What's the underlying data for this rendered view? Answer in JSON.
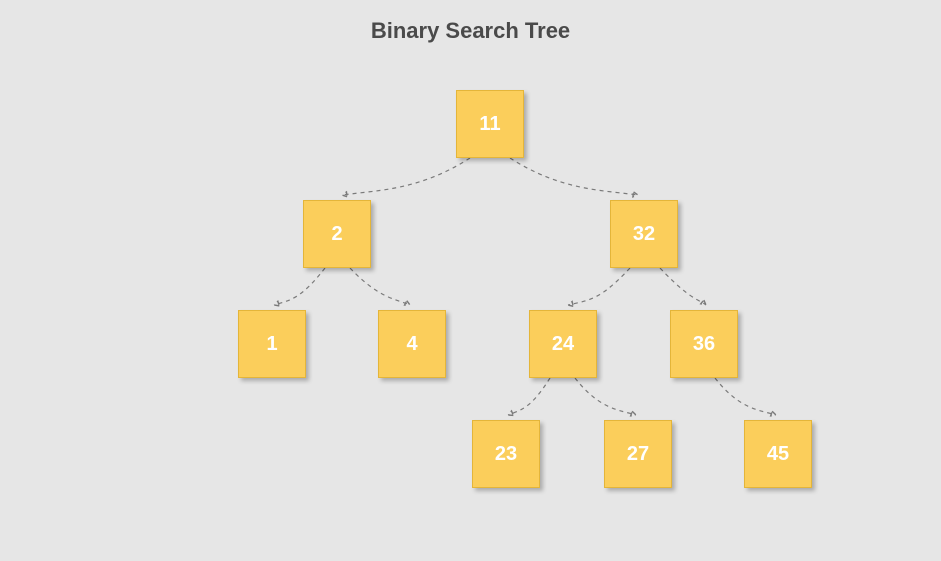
{
  "title": "Binary Search Tree",
  "colors": {
    "background": "#e6e6e6",
    "node_fill": "#fbce5b",
    "node_border": "#e4b539",
    "node_text": "#ffffff",
    "title_text": "#4a4a4a",
    "edge": "#7a7a7a"
  },
  "tree": {
    "value": 11,
    "left": {
      "value": 2,
      "left": {
        "value": 1
      },
      "right": {
        "value": 4
      }
    },
    "right": {
      "value": 32,
      "left": {
        "value": 24,
        "left": {
          "value": 23
        },
        "right": {
          "value": 27
        }
      },
      "right": {
        "value": 36,
        "right": {
          "value": 45
        }
      }
    }
  },
  "nodes": {
    "n11": "11",
    "n2": "2",
    "n32": "32",
    "n1": "1",
    "n4": "4",
    "n24": "24",
    "n36": "36",
    "n23": "23",
    "n27": "27",
    "n45": "45"
  }
}
